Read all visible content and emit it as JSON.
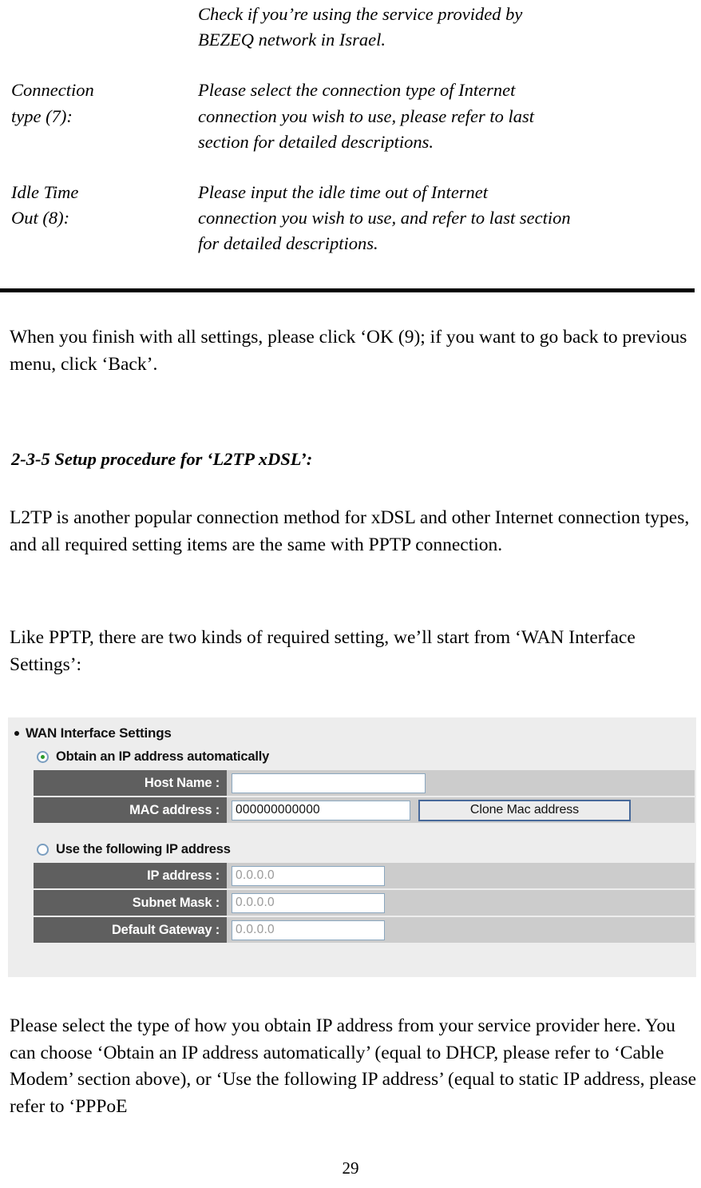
{
  "document": {
    "definitions": [
      {
        "term": "",
        "desc": "Check if you’re using the service provided by\nBEZEQ network in Israel."
      },
      {
        "term": "Connection\ntype (7):",
        "desc": "Please select the connection type of Internet\nconnection you wish to use, please refer to last\nsection for detailed descriptions."
      },
      {
        "term": "Idle Time\nOut (8):",
        "desc": "Please input the idle time out of Internet\nconnection you wish to use, and refer to last section\nfor detailed descriptions."
      }
    ],
    "paragraph_1": "When you finish with all settings, please click ‘OK (9); if you want to go back to previous menu, click ‘Back’.",
    "section_heading": "2-3-5 Setup procedure for ‘L2TP xDSL’:",
    "paragraph_2": "L2TP is another popular connection method for xDSL and other Internet connection types, and all required setting items are the same with PPTP connection.",
    "paragraph_3": "Like PPTP, there are two kinds of required setting, we’ll start from ‘WAN Interface Settings’:",
    "paragraph_4": "Please select the type of how you obtain IP address from your service provider here. You can choose ‘Obtain an IP address automatically’ (equal to DHCP, please refer to ‘Cable Modem’ section above), or ‘Use the following IP address’ (equal to static IP address, please refer to ‘PPPoE",
    "page_number": "29"
  },
  "router_ui": {
    "section_title": "WAN Interface Settings",
    "option_auto_label": "Obtain an IP address automatically",
    "option_static_label": "Use the following IP address",
    "fields": {
      "host_name_label": "Host Name :",
      "host_name_value": "",
      "mac_address_label": "MAC address :",
      "mac_address_value": "000000000000",
      "clone_mac_button": "Clone Mac address",
      "ip_address_label": "IP address :",
      "ip_address_value": "0.0.0.0",
      "subnet_mask_label": "Subnet Mask :",
      "subnet_mask_value": "0.0.0.0",
      "default_gateway_label": "Default Gateway :",
      "default_gateway_value": "0.0.0.0"
    },
    "colors": {
      "panel_bg": "#ededed",
      "label_cell_bg": "#5f5f5f",
      "row_bg": "#cccccc",
      "input_border": "#8ba7bf",
      "button_border": "#47699a",
      "radio_ring": "#7a9ec0",
      "radio_dot": "#2b9b2b"
    }
  }
}
